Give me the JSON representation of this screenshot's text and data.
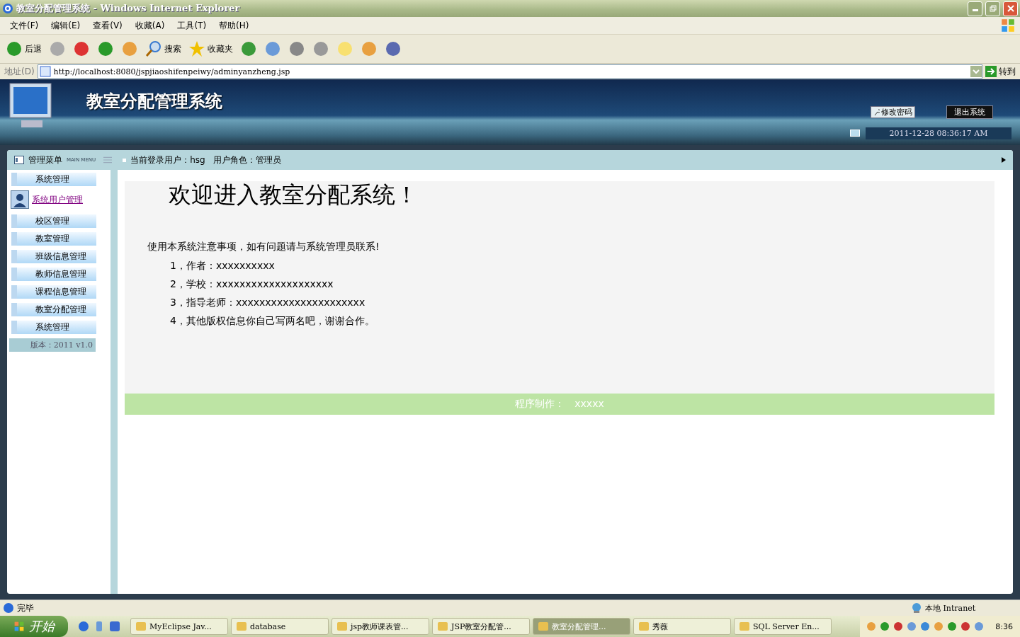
{
  "window": {
    "title": "教室分配管理系统 - Windows Internet Explorer"
  },
  "menu": [
    "文件(F)",
    "编辑(E)",
    "查看(V)",
    "收藏(A)",
    "工具(T)",
    "帮助(H)"
  ],
  "toolbar": [
    {
      "kind": "back",
      "label": "后退"
    },
    {
      "kind": "forward"
    },
    {
      "kind": "stop"
    },
    {
      "kind": "refresh"
    },
    {
      "kind": "home"
    },
    {
      "kind": "search",
      "label": "搜索"
    },
    {
      "kind": "favorites",
      "label": "收藏夹"
    },
    {
      "kind": "history"
    },
    {
      "kind": "mail"
    },
    {
      "kind": "print"
    },
    {
      "kind": "edit"
    },
    {
      "kind": "note"
    },
    {
      "kind": "folder"
    },
    {
      "kind": "research"
    }
  ],
  "address": {
    "label": "地址(D)",
    "value": "http://localhost:8080/jspjiaoshifenpeiwy/adminyanzheng.jsp",
    "go": "转到"
  },
  "header": {
    "title": "教室分配管理系统",
    "buttons": [
      "修改密码",
      "退出系统"
    ],
    "datetime": "2011-12-28 08:36:17 AM"
  },
  "menubar": {
    "title": "管理菜单",
    "subtitle": "MAIN MENU",
    "user": "当前登录用户：hsg   用户角色：管理员"
  },
  "sidebar": {
    "items": [
      {
        "kind": "button",
        "label": "系统管理"
      },
      {
        "kind": "link",
        "label": "系统用户管理"
      },
      {
        "kind": "button",
        "label": "校区管理"
      },
      {
        "kind": "button",
        "label": "教室管理"
      },
      {
        "kind": "button",
        "label": "班级信息管理"
      },
      {
        "kind": "button",
        "label": "教师信息管理"
      },
      {
        "kind": "button",
        "label": "课程信息管理"
      },
      {
        "kind": "button",
        "label": "教室分配管理"
      },
      {
        "kind": "button",
        "label": "系统管理"
      }
    ],
    "version": "版本：2011 v1.0"
  },
  "content": {
    "heading": "欢迎进入教室分配系统！",
    "notice": "使用本系统注意事项，如有问题请与系统管理员联系!",
    "lines": [
      "1，作者：xxxxxxxxxx",
      "2，学校：xxxxxxxxxxxxxxxxxxxx",
      "3，指导老师：xxxxxxxxxxxxxxxxxxxxxx",
      "4，其他版权信息你自己写两名吧，谢谢合作。"
    ],
    "footer": "程序制作：　xxxxx"
  },
  "status_bar": {
    "text": "完毕",
    "zone": "本地 Intranet"
  },
  "taskbar": {
    "start": "开始",
    "tasks": [
      {
        "label": "MyEclipse Jav...",
        "selected": false
      },
      {
        "label": "database",
        "selected": false
      },
      {
        "label": "jsp教师课表管...",
        "selected": false
      },
      {
        "label": "JSP教室分配管...",
        "selected": false
      },
      {
        "label": "教室分配管理...",
        "selected": true
      },
      {
        "label": "秀薇",
        "selected": false
      },
      {
        "label": "SQL Server En...",
        "selected": false
      }
    ],
    "clock": "8:36"
  }
}
